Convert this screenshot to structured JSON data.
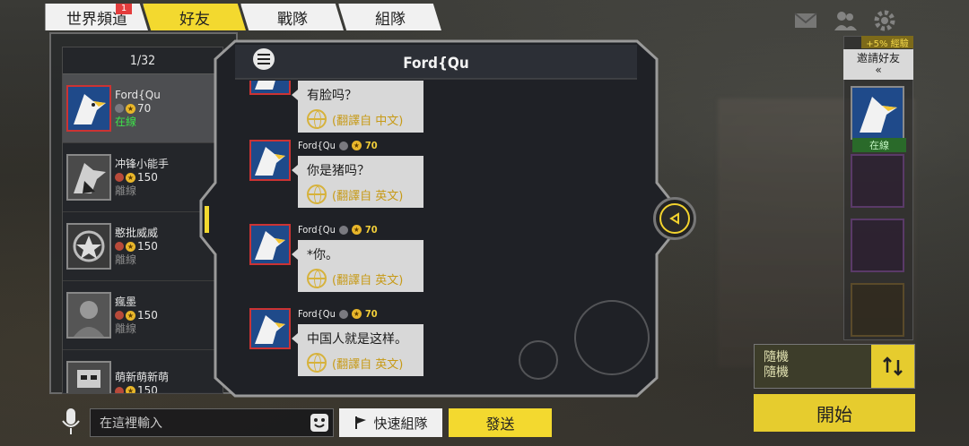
{
  "tabs": [
    {
      "label": "世界頻道",
      "badge": "1"
    },
    {
      "label": "好友"
    },
    {
      "label": "戰隊"
    },
    {
      "label": "組隊"
    }
  ],
  "friends": {
    "count": "1/32",
    "items": [
      {
        "name": "Ford{Qu",
        "level": "70",
        "status": "在線"
      },
      {
        "name": "冲锋小能手",
        "level": "150",
        "status": "離線"
      },
      {
        "name": "憨批威威",
        "level": "150",
        "status": "離線"
      },
      {
        "name": "瘋墨",
        "level": "150",
        "status": "離線"
      },
      {
        "name": "萌新萌新萌",
        "level": "150",
        "status": ""
      }
    ]
  },
  "chat": {
    "title": "Ford{Qu",
    "messages": [
      {
        "name": "",
        "level": "",
        "text": "有脸吗？",
        "translate": "(翻譯自 中文)"
      },
      {
        "name": "Ford{Qu",
        "level": "70",
        "text": "你是猪吗？",
        "translate": "(翻譯自 英文)"
      },
      {
        "name": "Ford{Qu",
        "level": "70",
        "text": "*你。",
        "translate": "(翻譯自 英文)"
      },
      {
        "name": "Ford{Qu",
        "level": "70",
        "text": "中国人就是这样。",
        "translate": "(翻譯自 英文)"
      }
    ]
  },
  "input": {
    "placeholder": "在這裡輸入"
  },
  "buttons": {
    "quick_team": "快速組隊",
    "send": "發送",
    "start": "開始"
  },
  "right": {
    "xp_bonus": "+5% 經驗",
    "invite": "邀請好友",
    "invite_arrow": "«",
    "slot_status": "在線",
    "mode_line1": "隨機",
    "mode_line2": "隨機"
  },
  "colors": {
    "accent": "#f3d92f",
    "online": "#3ee04a",
    "offline": "#8a8a8a"
  }
}
